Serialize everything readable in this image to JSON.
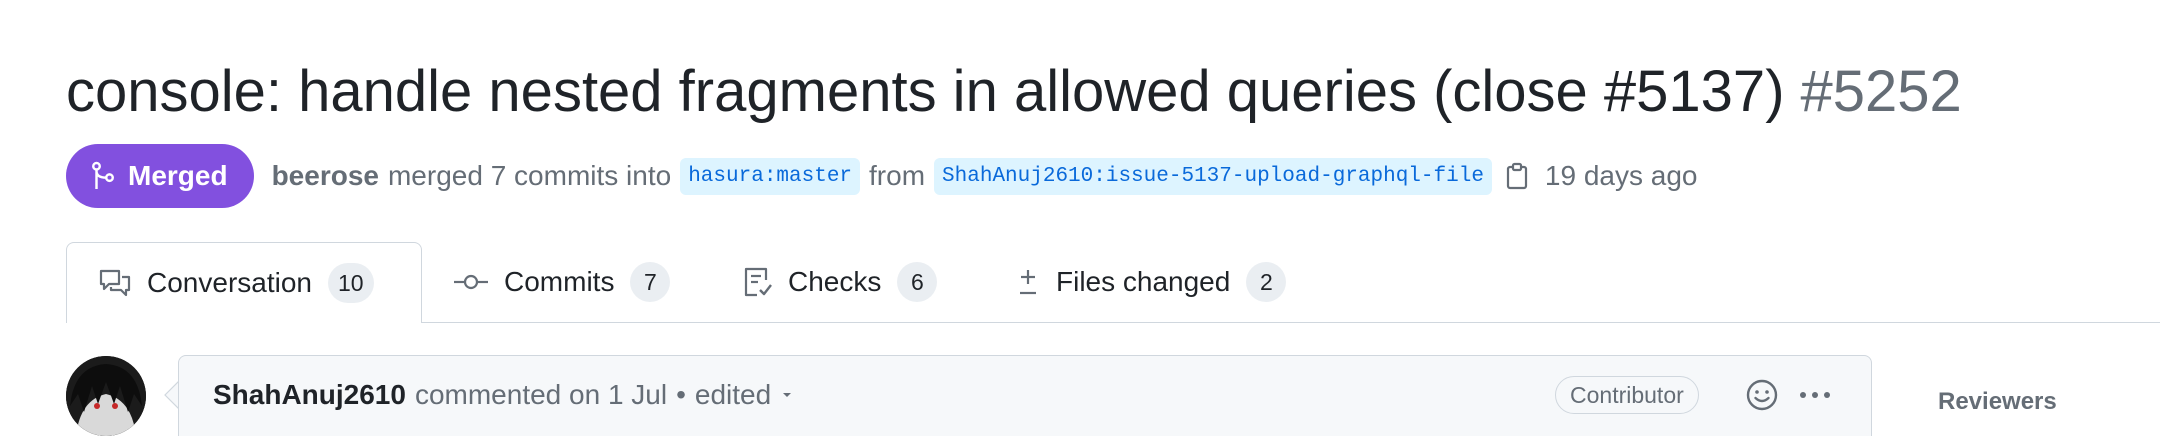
{
  "pr": {
    "title": "console: handle nested fragments in allowed queries (close #5137)",
    "number": "#5252",
    "state": "Merged",
    "author": "beerose",
    "action_text": "merged 7 commits into",
    "base_branch": "hasura:master",
    "from_text": "from",
    "head_branch": "ShahAnuj2610:issue-5137-upload-graphql-file",
    "time_ago": "19 days ago"
  },
  "tabs": [
    {
      "label": "Conversation",
      "count": "10",
      "icon": "comment-discussion-icon",
      "selected": true
    },
    {
      "label": "Commits",
      "count": "7",
      "icon": "git-commit-icon",
      "selected": false
    },
    {
      "label": "Checks",
      "count": "6",
      "icon": "checklist-icon",
      "selected": false
    },
    {
      "label": "Files changed",
      "count": "2",
      "icon": "file-diff-icon",
      "selected": false
    }
  ],
  "comment": {
    "author": "ShahAnuj2610",
    "action": "commented on 1 Jul",
    "separator": "•",
    "edited": "edited",
    "role": "Contributor"
  },
  "sidebar": {
    "reviewers_heading": "Reviewers"
  },
  "colors": {
    "merged_purple": "#8250df",
    "link_blue": "#0969da",
    "branch_bg": "#ddf4ff",
    "muted_text": "#656d76",
    "border": "#d0d7de"
  }
}
